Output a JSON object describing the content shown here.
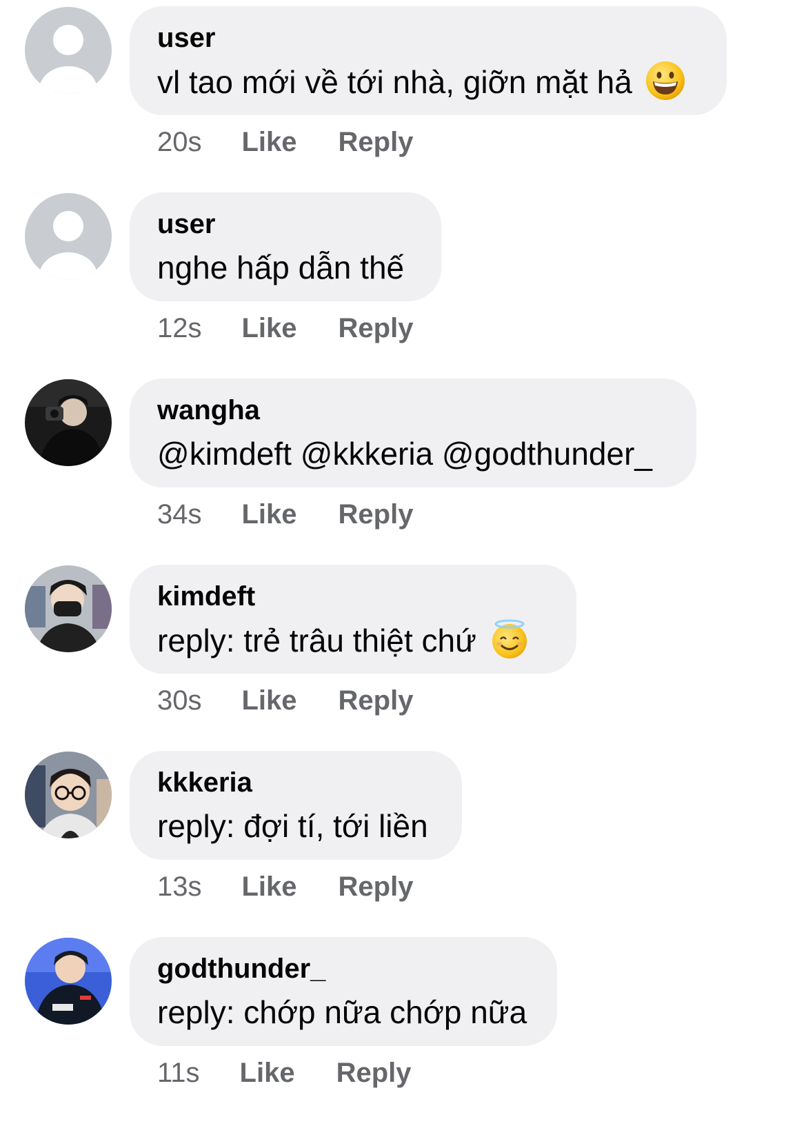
{
  "comments": [
    {
      "username": "user",
      "text": "vl tao mới về tới nhà, giỡn mặt hả",
      "emoji": "grinning-face",
      "time": "20s",
      "like": "Like",
      "reply": "Reply",
      "avatar": "default"
    },
    {
      "username": "user",
      "text": "nghe hấp dẫn thế",
      "emoji": "",
      "time": "12s",
      "like": "Like",
      "reply": "Reply",
      "avatar": "default"
    },
    {
      "username": "wangha",
      "text": "@kimdeft @kkkeria @godthunder_",
      "emoji": "",
      "time": "34s",
      "like": "Like",
      "reply": "Reply",
      "avatar": "photo"
    },
    {
      "username": "kimdeft",
      "text": "reply: trẻ trâu thiệt chứ",
      "emoji": "smiling-face-with-halo",
      "time": "30s",
      "like": "Like",
      "reply": "Reply",
      "avatar": "photo"
    },
    {
      "username": "kkkeria",
      "text": "reply: đợi tí, tới liền",
      "emoji": "",
      "time": "13s",
      "like": "Like",
      "reply": "Reply",
      "avatar": "photo"
    },
    {
      "username": "godthunder_",
      "text": "reply: chớp nữa chớp nữa",
      "emoji": "",
      "time": "11s",
      "like": "Like",
      "reply": "Reply",
      "avatar": "photo"
    }
  ],
  "colors": {
    "bubble": "#f0f0f2",
    "text": "#050505",
    "meta": "#65676b",
    "default_avatar_bg": "#c9ccd1"
  }
}
